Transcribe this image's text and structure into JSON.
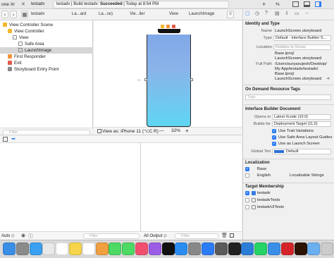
{
  "titlebar": {
    "scheme_device": "one Xr",
    "scheme": "testadv",
    "status_prefix": "testadv | Build testadv:",
    "status_result": "Succeeded",
    "status_time": "| Today at 8:54 PM"
  },
  "breadcrumbs": [
    "testadv",
    "La...ard",
    "La...se)",
    "Vie...ller",
    "View",
    "LaunchImage"
  ],
  "navigator": {
    "items": [
      {
        "label": "View Controller Scene",
        "indent": 0,
        "color": "#f3b52c"
      },
      {
        "label": "View Controller",
        "indent": 1,
        "color": "#f3b52c"
      },
      {
        "label": "View",
        "indent": 2,
        "color": "#ffffff"
      },
      {
        "label": "Safe Area",
        "indent": 3,
        "color": "#ffffff"
      },
      {
        "label": "LaunchImage",
        "indent": 3,
        "color": "#ffffff"
      },
      {
        "label": "First Responder",
        "indent": 1,
        "color": "#f3923a"
      },
      {
        "label": "Exit",
        "indent": 1,
        "color": "#e35a4a"
      },
      {
        "label": "Storyboard Entry Point",
        "indent": 1,
        "color": "#888888"
      }
    ],
    "selected_index": 4,
    "filter_placeholder": "Filter"
  },
  "canvas": {
    "view_as": "View as: iPhone 11 (",
    "view_as_shortcut": "⌥C R)",
    "zoom": "32%",
    "zoom_minus": "—",
    "zoom_plus": "+"
  },
  "debug": {
    "auto_label": "Auto ◇",
    "output_label": "All Output ◇",
    "filter_placeholder": "Filter"
  },
  "inspector": {
    "identity_head": "Identity and Type",
    "name_label": "Name",
    "name_value": "LaunchScreen.storyboard",
    "type_label": "Type",
    "type_value": "Default - Interface Builder S...",
    "location_label": "Location",
    "location_value": "Relative to Group",
    "location_path1": "Base.lproj/",
    "location_path2": "LaunchScreen.storyboard",
    "fullpath_label": "Full Path",
    "fullpath_lines": [
      "/Users/suryasujesh/Desktop/",
      "My App/testadv/testadv/",
      "Base.lproj/",
      "LaunchScreen.storyboard"
    ],
    "ondemand_head": "On Demand Resource Tags",
    "tags_placeholder": "Tags",
    "ibdoc_head": "Interface Builder Document",
    "opens_label": "Opens in",
    "opens_value": "Latest Xcode (10.0)",
    "builds_label": "Builds for",
    "builds_value": "Deployment Target (11.0)",
    "check_trait": "Use Trait Variations",
    "check_safe": "Use Safe Area Layout Guides",
    "check_launch": "Use as Launch Screen",
    "tint_label": "Global Tint",
    "tint_value": "Default",
    "tint_color": "#2b6fd8",
    "localization_head": "Localization",
    "loc_base": "Base",
    "loc_english": "English",
    "loc_english_value": "Localizable Strings",
    "target_head": "Target Membership",
    "targets": [
      {
        "label": "testadv",
        "checked": true
      },
      {
        "label": "testadvTests",
        "checked": false
      },
      {
        "label": "testadvUITests",
        "checked": false
      }
    ]
  },
  "dock": {
    "apps": [
      {
        "name": "finder",
        "color": "#3a8ee6"
      },
      {
        "name": "launchpad",
        "color": "#8a8a8a"
      },
      {
        "name": "safari",
        "color": "#3aa0f0"
      },
      {
        "name": "chrome",
        "color": "#e8e8e8"
      },
      {
        "name": "calendar",
        "color": "#ffffff"
      },
      {
        "name": "notes",
        "color": "#f6d54a"
      },
      {
        "name": "reminders",
        "color": "#ffffff"
      },
      {
        "name": "photos",
        "color": "#f0a040"
      },
      {
        "name": "messages",
        "color": "#4cd964"
      },
      {
        "name": "facetime",
        "color": "#4cd964"
      },
      {
        "name": "music",
        "color": "#f0506e"
      },
      {
        "name": "podcasts",
        "color": "#9b5de5"
      },
      {
        "name": "apple-tv",
        "color": "#111111"
      },
      {
        "name": "app-store",
        "color": "#2b8cf0"
      },
      {
        "name": "system-preferences",
        "color": "#888888"
      },
      {
        "name": "xcode",
        "color": "#2b7cf6"
      },
      {
        "name": "simulator",
        "color": "#5a5a5a"
      },
      {
        "name": "terminal",
        "color": "#222222"
      },
      {
        "name": "vscode",
        "color": "#2b7ed8"
      },
      {
        "name": "whatsapp",
        "color": "#25d366"
      },
      {
        "name": "finder-2",
        "color": "#3a8ee6"
      },
      {
        "name": "acrobat",
        "color": "#d4242a"
      },
      {
        "name": "illustrator",
        "color": "#2c1203"
      },
      {
        "name": "folder",
        "color": "#6ab0f0"
      },
      {
        "name": "trash",
        "color": "#cccccc"
      }
    ]
  }
}
